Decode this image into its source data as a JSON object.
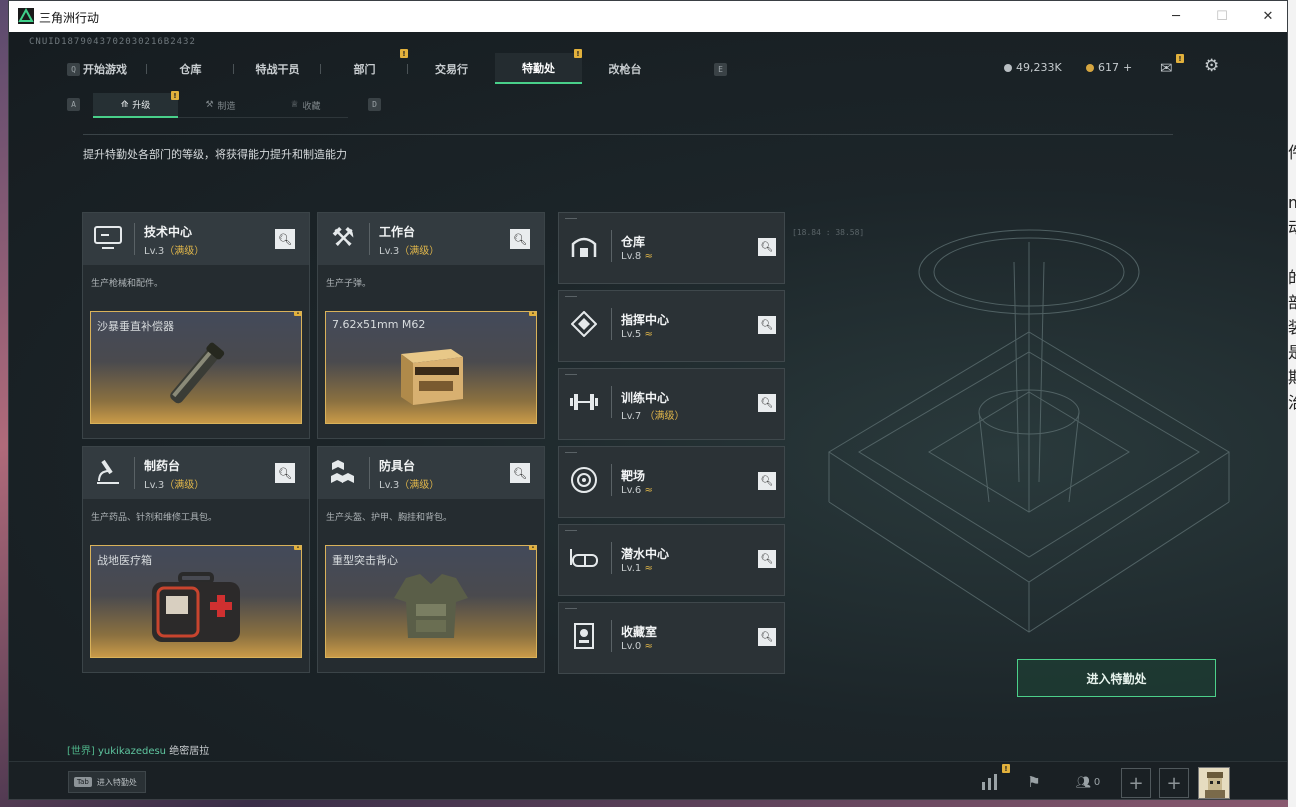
{
  "window": {
    "title": "三角洲行动"
  },
  "uid": "CNUID1879043702030216B2432",
  "nav": {
    "left_key": "Q",
    "right_key": "E",
    "items": [
      {
        "label": "开始游戏"
      },
      {
        "label": "仓库"
      },
      {
        "label": "特战干员"
      },
      {
        "label": "部门",
        "badge": "!"
      },
      {
        "label": "交易行"
      },
      {
        "label": "特勤处",
        "badge": "!",
        "active": true
      },
      {
        "label": "改枪台"
      }
    ]
  },
  "currency": {
    "silver": "49,233K",
    "gold": "617",
    "gold_plus": "+"
  },
  "mail_badge": "!",
  "subnav": {
    "left_key": "A",
    "right_key": "D",
    "items": [
      {
        "label": "升级",
        "badge": "!",
        "active": true
      },
      {
        "label": "制造"
      },
      {
        "label": "收藏"
      }
    ]
  },
  "description": "提升特勤处各部门的等级，将获得能力提升和制造能力",
  "departments": [
    {
      "name": "技术中心",
      "level": "Lv.3",
      "max": "（满级）",
      "desc": "生产枪械和配件。",
      "item": "沙暴垂直补偿器",
      "badge": "!",
      "icon": "monitor-icon"
    },
    {
      "name": "工作台",
      "level": "Lv.3",
      "max": "（满级）",
      "desc": "生产子弹。",
      "item": "7.62x51mm M62",
      "badge": "!",
      "icon": "tools-icon"
    },
    {
      "name": "制药台",
      "level": "Lv.3",
      "max": "（满级）",
      "desc": "生产药品、针剂和维修工具包。",
      "item": "战地医疗箱",
      "badge": "!",
      "icon": "microscope-icon"
    },
    {
      "name": "防具台",
      "level": "Lv.3",
      "max": "（满级）",
      "desc": "生产头盔、护甲、胸挂和背包。",
      "item": "重型突击背心",
      "badge": "!",
      "icon": "cubes-icon"
    }
  ],
  "buildings": [
    {
      "name": "仓库",
      "level": "Lv.8",
      "up": "≈",
      "max": "",
      "icon": "warehouse-icon"
    },
    {
      "name": "指挥中心",
      "level": "Lv.5",
      "up": "≈",
      "max": "",
      "icon": "command-icon"
    },
    {
      "name": "训练中心",
      "level": "Lv.7",
      "up": "",
      "max": "（满级）",
      "icon": "dumbbell-icon"
    },
    {
      "name": "靶场",
      "level": "Lv.6",
      "up": "≈",
      "max": "",
      "icon": "target-icon"
    },
    {
      "name": "潜水中心",
      "level": "Lv.1",
      "up": "≈",
      "max": "",
      "icon": "diving-mask-icon"
    },
    {
      "name": "收藏室",
      "level": "Lv.0",
      "up": "≈",
      "max": "",
      "icon": "collection-icon"
    }
  ],
  "enter_button": "进入特勤处",
  "chat": {
    "channel": "[世界]",
    "user": "yukikazedesu",
    "message": "绝密居拉"
  },
  "bottom": {
    "tab_key": "Tab",
    "tab_label": "进入特勤处",
    "friends_count": "0",
    "stats_badge": "!"
  },
  "coordinate_readout": "[18.84 : 38.58]",
  "colors": {
    "accent": "#49d08a",
    "badge": "#e2b13c",
    "max_level": "#e0b64a"
  }
}
